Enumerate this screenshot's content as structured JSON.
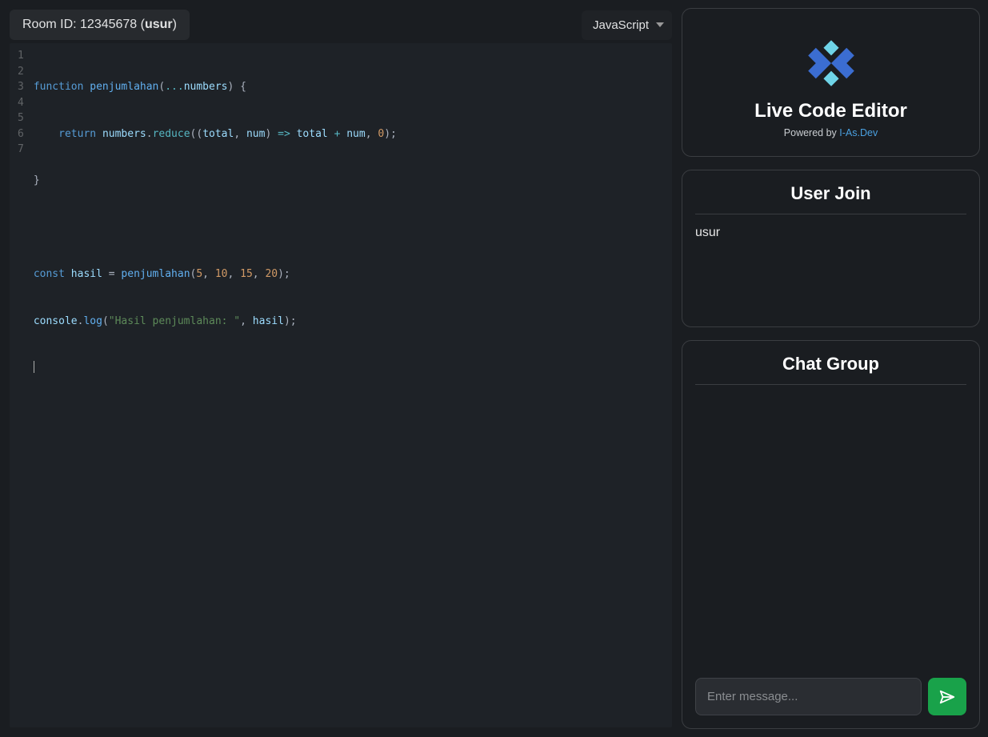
{
  "header": {
    "room_label_prefix": "Room ID: ",
    "room_id": "12345678",
    "username": "usur",
    "language": "JavaScript"
  },
  "editor": {
    "line_count": 7,
    "code": {
      "l1": {
        "kw": "function",
        "fn": "penjumlahan",
        "spread": "...",
        "arg": "numbers"
      },
      "l2": {
        "kw": "return",
        "obj": "numbers",
        "method": "reduce",
        "p1": "total",
        "p2": "num",
        "arrow": "=>",
        "a": "total",
        "op": "+",
        "b": "num",
        "init": "0"
      },
      "l3": {
        "brace": "}"
      },
      "l5": {
        "kw": "const",
        "name": "hasil",
        "eq": "=",
        "fn": "penjumlahan",
        "n1": "5",
        "n2": "10",
        "n3": "15",
        "n4": "20"
      },
      "l6": {
        "obj": "console",
        "method": "log",
        "str": "\"Hasil penjumlahan: \"",
        "arg": "hasil"
      }
    }
  },
  "sidebar": {
    "app_title": "Live Code Editor",
    "powered_prefix": "Powered by ",
    "powered_link": "I-As.Dev",
    "user_join_title": "User Join",
    "users": [
      "usur"
    ],
    "chat_title": "Chat Group",
    "chat_placeholder": "Enter message..."
  },
  "colors": {
    "accent_green": "#19a24a",
    "logo_blue": "#3b6dd1",
    "logo_cyan": "#6fd4e8"
  }
}
